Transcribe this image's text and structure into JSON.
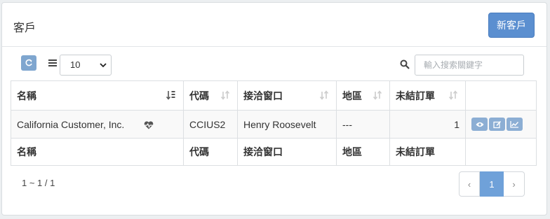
{
  "panel": {
    "title": "客戶",
    "new_button": "新客戶"
  },
  "toolbar": {
    "page_size": "10",
    "search_placeholder": "輸入搜索關鍵字"
  },
  "table": {
    "columns": [
      "名稱",
      "代碼",
      "接洽窗口",
      "地區",
      "未結訂單"
    ],
    "rows": [
      {
        "name": "California Customer, Inc.",
        "code": "CCIUS2",
        "contact": "Henry Roosevelt",
        "region": "---",
        "open_orders": "1"
      }
    ]
  },
  "footer": {
    "range": "1 ~ 1 / 1"
  },
  "pager": {
    "prev": "‹",
    "current": "1",
    "next": "›"
  },
  "colors": {
    "accent": "#5b8fd0",
    "action_button": "#8caed4",
    "pager_active": "#6fa1d9"
  }
}
